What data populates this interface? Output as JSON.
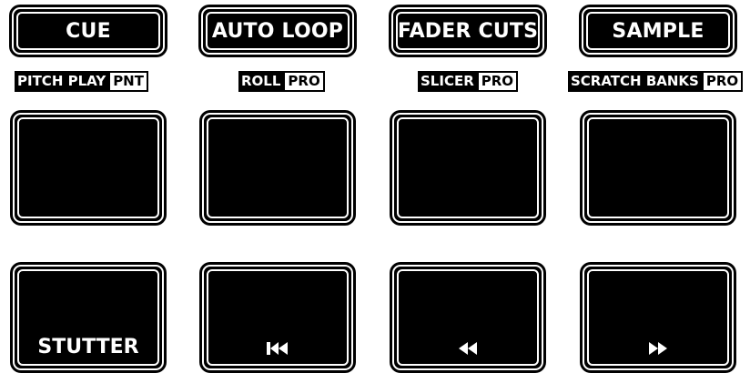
{
  "modes": {
    "cue": "CUE",
    "auto_loop": "AUTO LOOP",
    "fader_cuts": "FADER CUTS",
    "sample": "SAMPLE"
  },
  "sublabels": {
    "pitch_play": {
      "main": "PITCH PLAY",
      "tag": "PNT"
    },
    "roll": {
      "main": "ROLL",
      "tag": "PRO"
    },
    "slicer": {
      "main": "SLICER",
      "tag": "PRO"
    },
    "scratch_banks": {
      "main": "SCRATCH BANKS",
      "tag": "PRO"
    }
  },
  "pads": {
    "stutter": "STUTTER"
  },
  "icons": {
    "pad6": "skip-back-icon",
    "pad7": "rewind-icon",
    "pad8": "fast-forward-icon"
  },
  "colors": {
    "pad": "#000000",
    "outline": "#ffffff"
  }
}
